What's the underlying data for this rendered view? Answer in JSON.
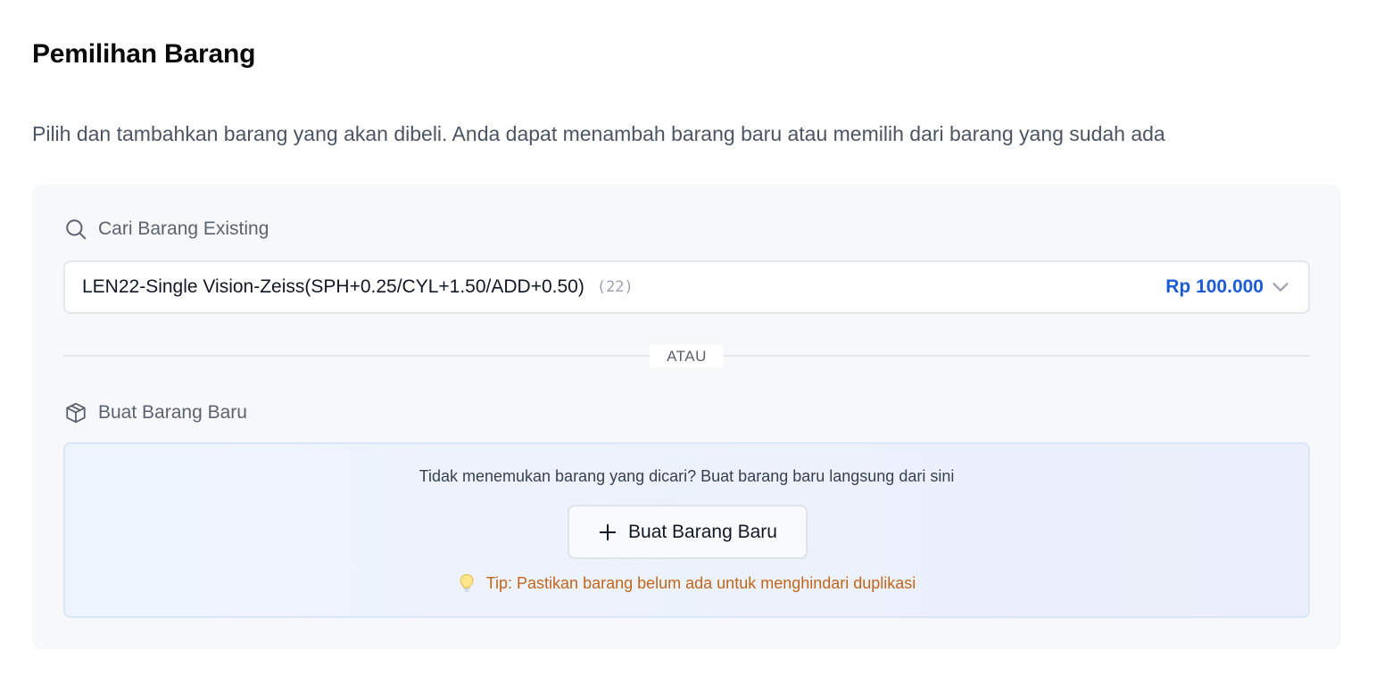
{
  "header": {
    "title": "Pemilihan Barang",
    "description": "Pilih dan tambahkan barang yang akan dibeli. Anda dapat menambah barang baru atau memilih dari barang yang sudah ada"
  },
  "search_section": {
    "label": "Cari Barang Existing",
    "icon": "search-icon",
    "selected_item": {
      "name": "LEN22-Single Vision-Zeiss(SPH+0.25/CYL+1.50/ADD+0.50)",
      "count": "(22)",
      "price": "Rp 100.000"
    }
  },
  "divider": {
    "text": "ATAU"
  },
  "create_section": {
    "label": "Buat Barang Baru",
    "icon": "box-icon",
    "prompt": "Tidak menemukan barang yang dicari? Buat barang baru langsung dari sini",
    "button_label": "Buat Barang Baru",
    "tip": "Tip: Pastikan barang belum ada untuk menghindari duplikasi"
  },
  "colors": {
    "price": "#1d5bd6",
    "tip": "#c2661b",
    "panel_bg": "#f7f8fa"
  }
}
